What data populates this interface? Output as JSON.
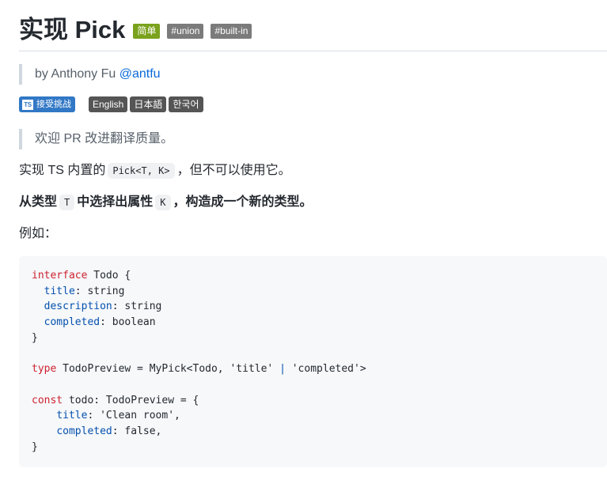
{
  "header": {
    "title": "实现 Pick",
    "difficulty": "简单",
    "tags": [
      "#union",
      "#built-in"
    ]
  },
  "author": {
    "prefix": "by Anthony Fu",
    "handle": "@antfu"
  },
  "badges": {
    "take_challenge_icon": "TS",
    "take_challenge": "接受挑战",
    "languages": [
      "English",
      "日本語",
      "한국어"
    ]
  },
  "translate_note": "欢迎 PR 改进翻译质量。",
  "description": {
    "p1_before": "实现 TS 内置的",
    "p1_code": "Pick<T, K>",
    "p1_after": "，但不可以使用它。",
    "p2_part1": "从类型",
    "p2_code1": "T",
    "p2_part2": "中选择出属性",
    "p2_code2": "K",
    "p2_part3": "，构造成一个新的类型。",
    "p3": "例如："
  },
  "code_block": {
    "language": "typescript",
    "lines": [
      "interface Todo {",
      "  title: string",
      "  description: string",
      "  completed: boolean",
      "}",
      "",
      "type TodoPreview = MyPick<Todo, 'title' | 'completed'>",
      "",
      "const todo: TodoPreview = {",
      "    title: 'Clean room',",
      "    completed: false,",
      "}"
    ]
  },
  "colors": {
    "difficulty_badge": "#7aa21d",
    "tag_badge": "#7b7b7b",
    "take_challenge_badge": "#3178c6",
    "language_badge": "#555555",
    "link": "#0969da",
    "code_keyword": "#cf222e",
    "code_property": "#0550ae",
    "code_background": "#f6f8fa"
  }
}
